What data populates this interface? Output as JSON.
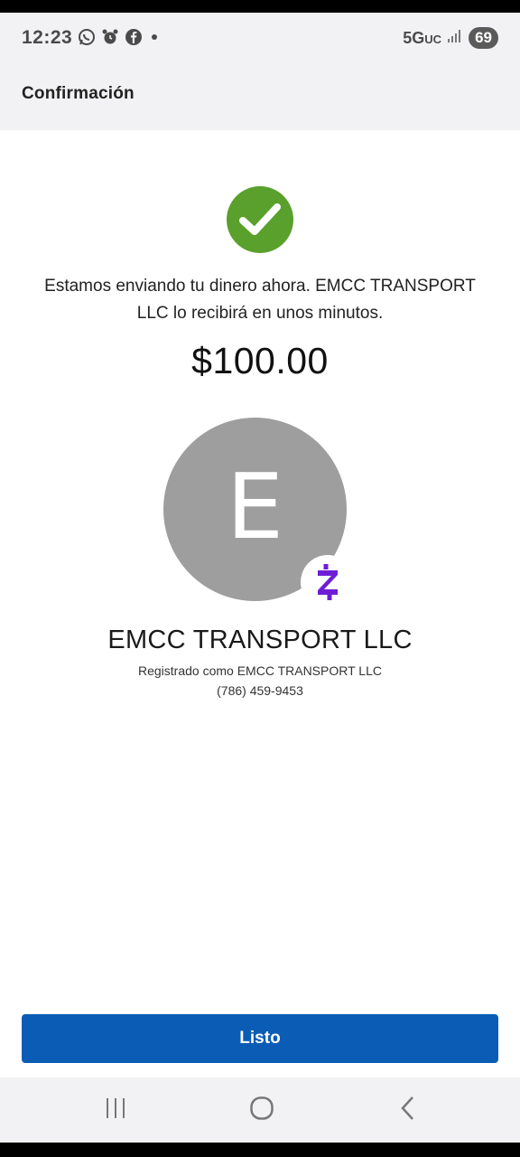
{
  "status_bar": {
    "time": "12:23",
    "network": "5G",
    "network_sub": "UC",
    "battery": "69",
    "icons": [
      "whatsapp-icon",
      "alarm-icon",
      "facebook-icon",
      "dot-icon",
      "signal-icon"
    ]
  },
  "header": {
    "title": "Confirmación"
  },
  "confirmation": {
    "message": "Estamos enviando tu dinero ahora. EMCC TRANSPORT LLC lo recibirá en unos minutos.",
    "amount": "$100.00"
  },
  "recipient": {
    "initial": "E",
    "name": "EMCC TRANSPORT LLC",
    "registered_as": "Registrado como EMCC TRANSPORT LLC",
    "phone": "(786) 459-9453",
    "badge_icon": "zelle-icon"
  },
  "actions": {
    "done_label": "Listo"
  },
  "colors": {
    "accent": "#0b5cb5",
    "success": "#5aa02c",
    "zelle": "#6d1ed4",
    "avatar_bg": "#9e9e9e"
  },
  "nav": {
    "icons": [
      "recent-apps-icon",
      "home-icon",
      "back-icon"
    ]
  }
}
